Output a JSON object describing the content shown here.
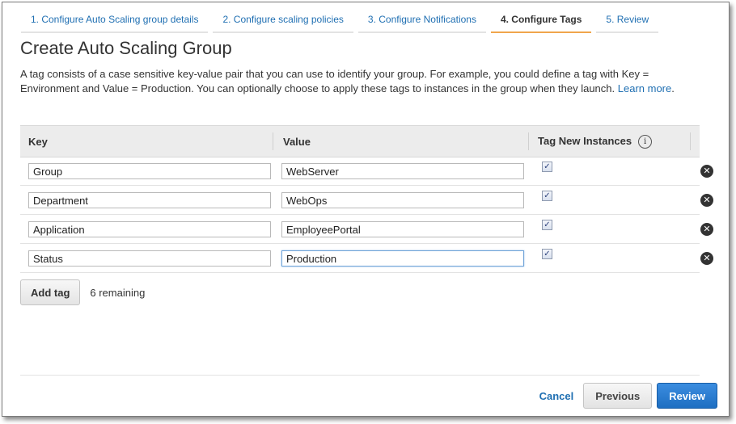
{
  "wizard": {
    "steps": [
      {
        "label": "1. Configure Auto Scaling group details"
      },
      {
        "label": "2. Configure scaling policies"
      },
      {
        "label": "3. Configure Notifications"
      },
      {
        "label": "4. Configure Tags"
      },
      {
        "label": "5. Review"
      }
    ],
    "active_step": 3
  },
  "page": {
    "title": "Create Auto Scaling Group",
    "description": "A tag consists of a case sensitive key-value pair that you can use to identify your group. For example, you could define a tag with Key = Environment and Value = Production. You can optionally choose to apply these tags to instances in the group when they launch.",
    "learn_more": "Learn more",
    "period": "."
  },
  "table": {
    "headers": {
      "key": "Key",
      "value": "Value",
      "tag_new": "Tag New Instances",
      "info": "i"
    },
    "rows": [
      {
        "key": "Group",
        "value": "WebServer",
        "tag_new": true
      },
      {
        "key": "Department",
        "value": "WebOps",
        "tag_new": true
      },
      {
        "key": "Application",
        "value": "EmployeePortal",
        "tag_new": true
      },
      {
        "key": "Status",
        "value": "Production",
        "tag_new": true
      }
    ]
  },
  "add_tag": {
    "label": "Add tag",
    "remaining": "6 remaining"
  },
  "footer": {
    "cancel": "Cancel",
    "previous": "Previous",
    "review": "Review"
  },
  "colors": {
    "link": "#1f6fb2",
    "active_tab_underline": "#f0a64c",
    "primary_button": "#1e6fc2"
  },
  "icons": {
    "info": "info-icon",
    "remove": "remove-circle-icon",
    "checkbox": "checkmark-icon"
  }
}
